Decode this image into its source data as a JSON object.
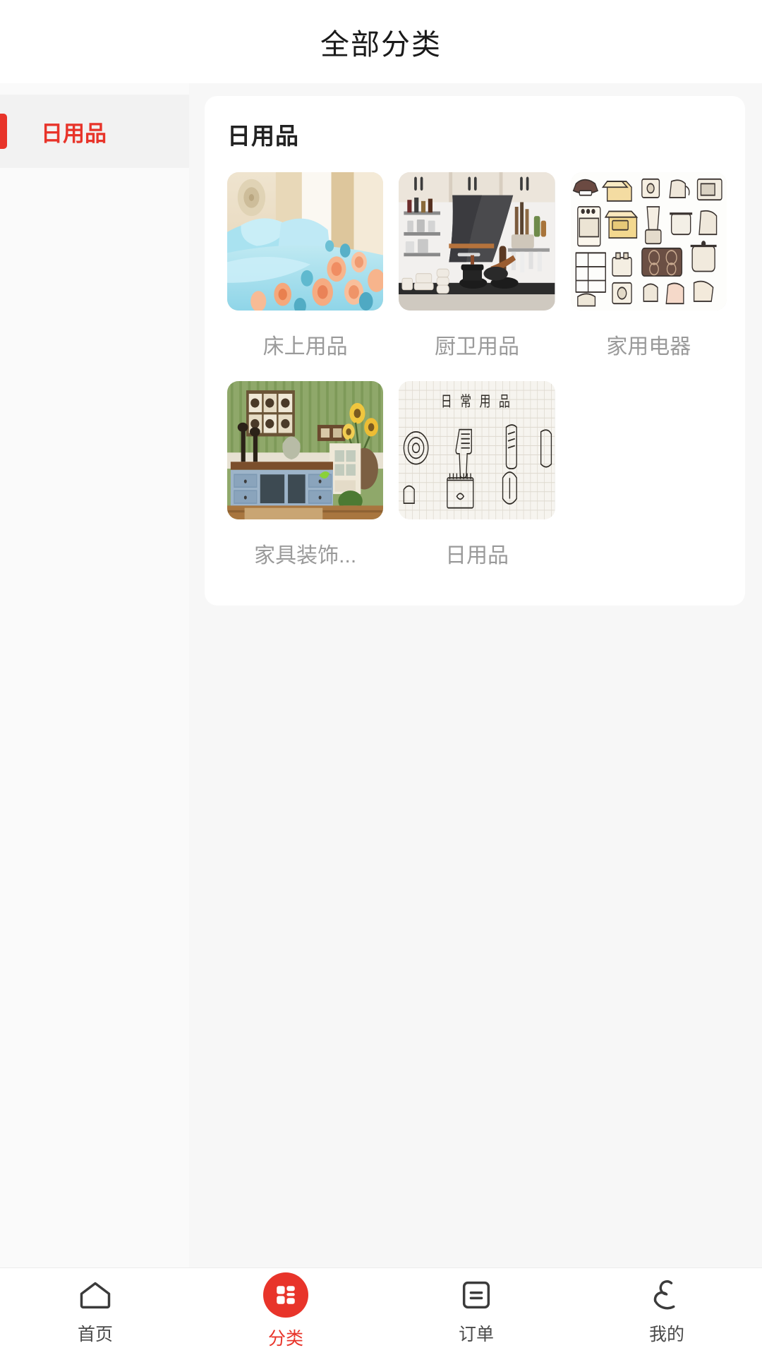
{
  "header": {
    "title": "全部分类"
  },
  "sidebar": {
    "items": [
      {
        "label": "日用品",
        "active": true
      }
    ]
  },
  "content": {
    "card_title": "日用品",
    "items": [
      {
        "label": "床上用品",
        "image": "bedding-photo"
      },
      {
        "label": "厨卫用品",
        "image": "kitchen-photo"
      },
      {
        "label": "家用电器",
        "image": "appliances-illustration"
      },
      {
        "label": "家具装饰...",
        "image": "furniture-photo"
      },
      {
        "label": "日用品",
        "image": "daily-goods-sketch"
      }
    ]
  },
  "tabbar": {
    "items": [
      {
        "label": "首页",
        "icon": "home-icon",
        "active": false
      },
      {
        "label": "分类",
        "icon": "grid-icon",
        "active": true
      },
      {
        "label": "订单",
        "icon": "order-icon",
        "active": false
      },
      {
        "label": "我的",
        "icon": "profile-icon",
        "active": false
      }
    ]
  },
  "colors": {
    "accent": "#e8342a",
    "page_bg": "#f7f7f7",
    "card_bg": "#ffffff",
    "label_gray": "#9a9a9a"
  }
}
